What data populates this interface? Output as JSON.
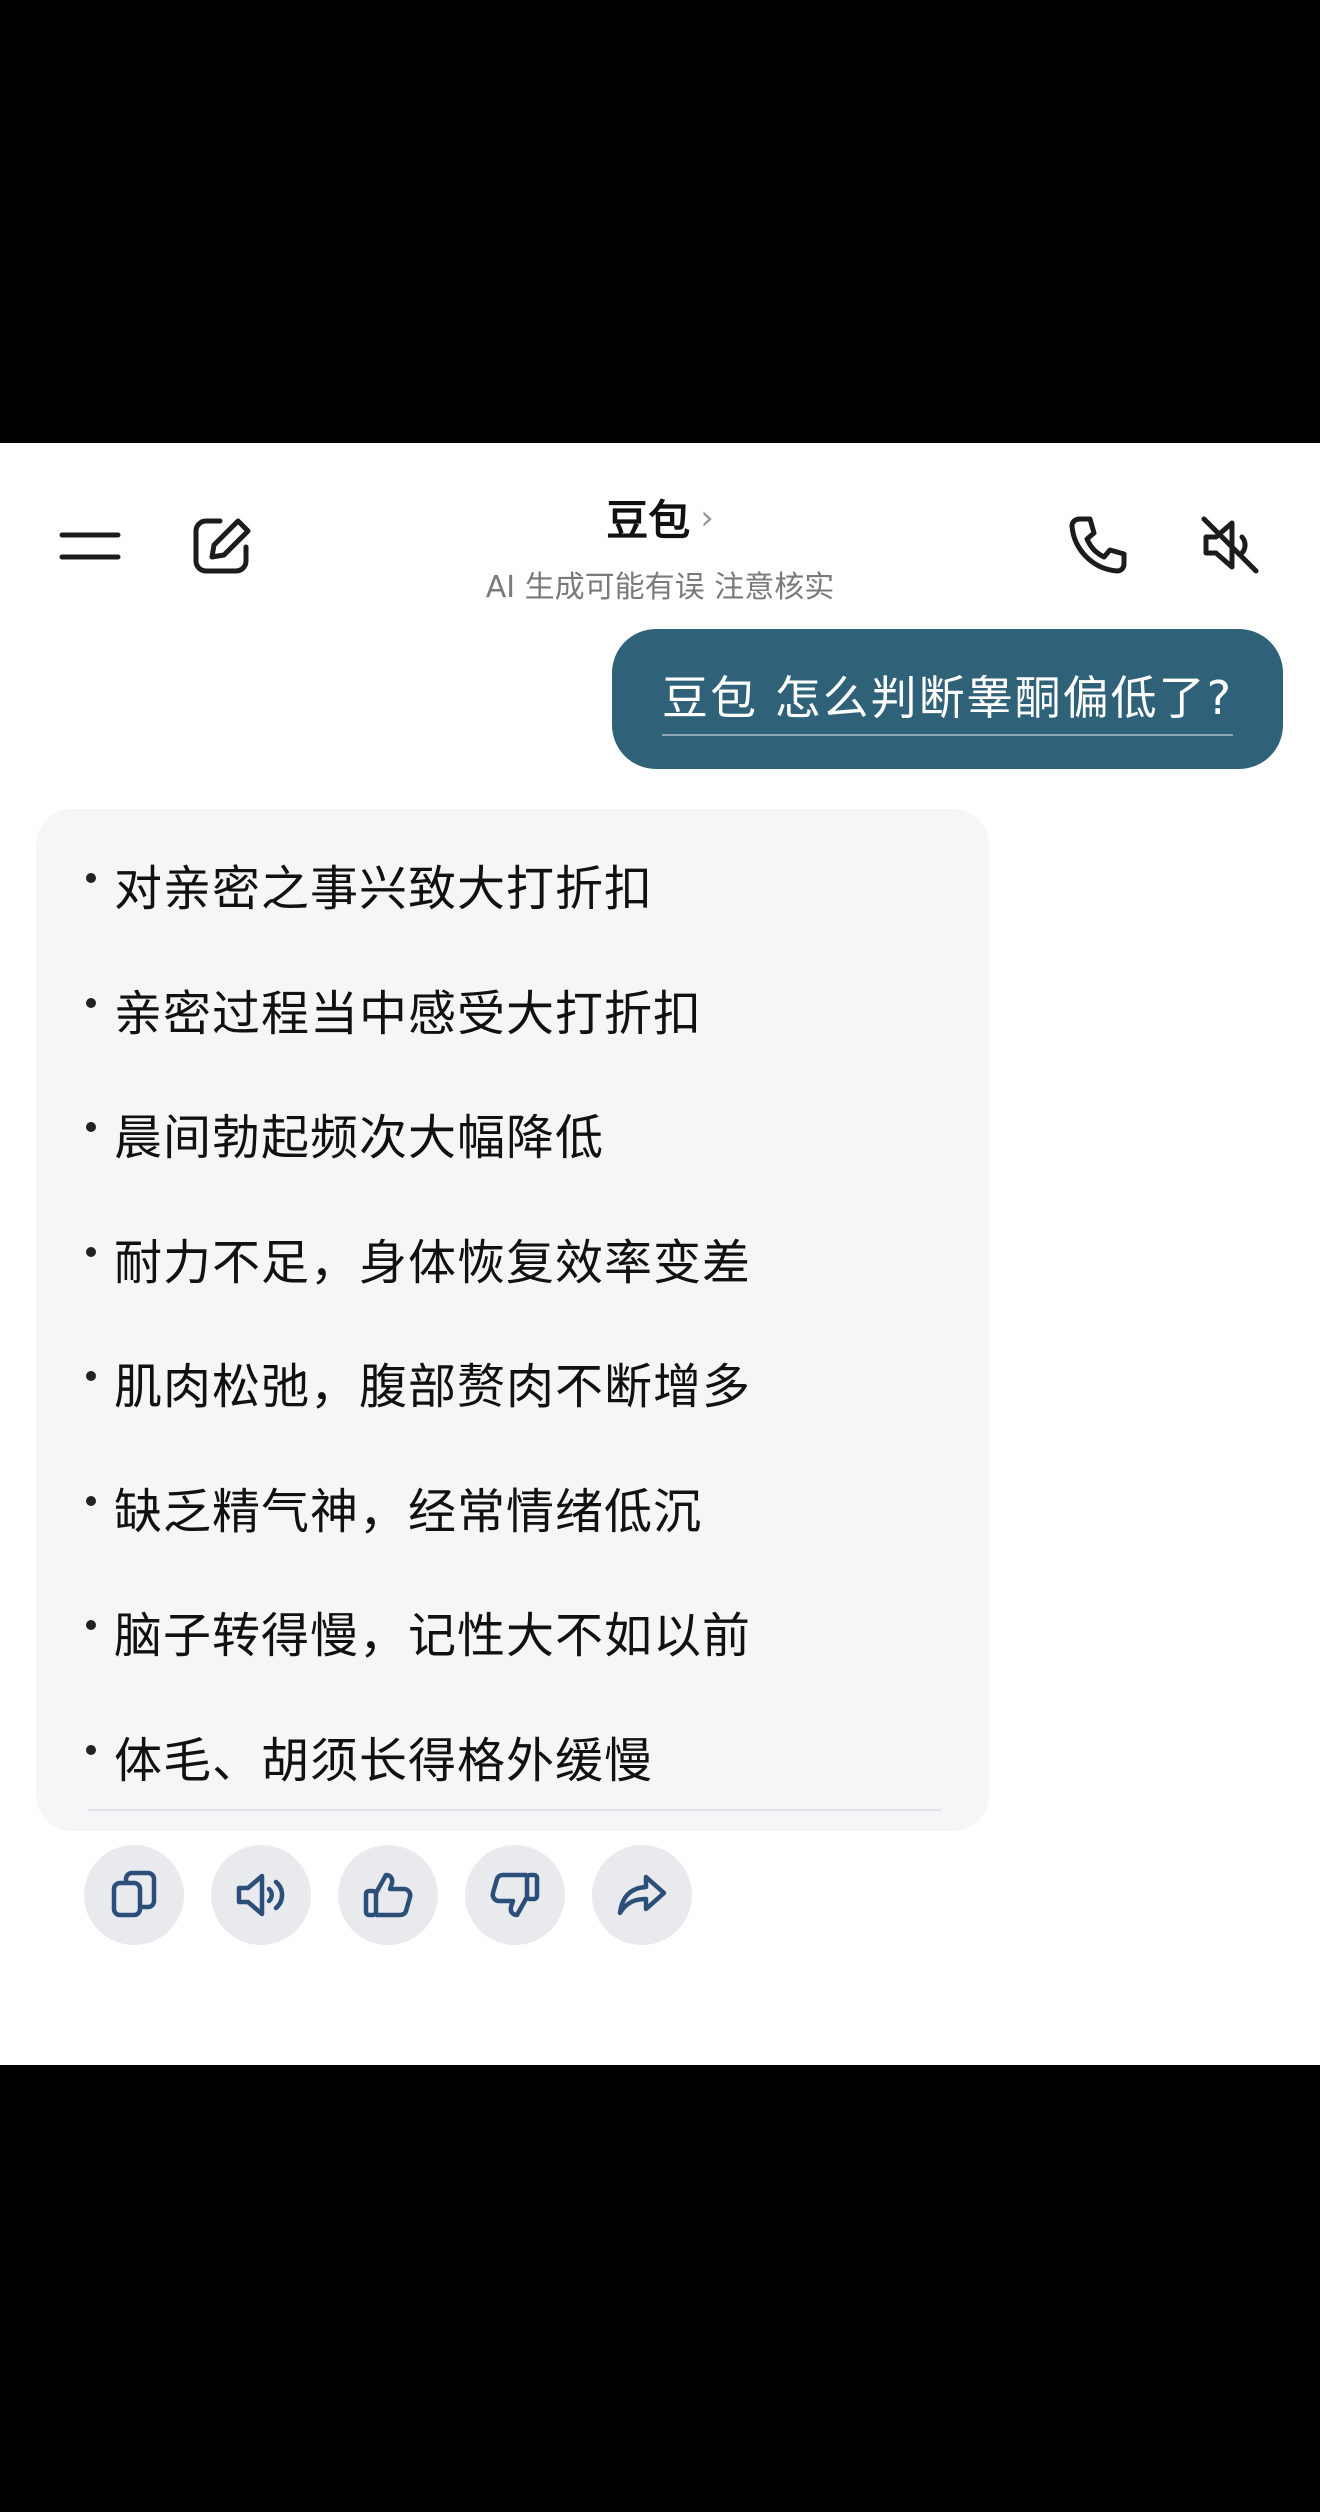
{
  "header": {
    "title": "豆包",
    "title_chevron": "›",
    "subtitle": "AI 生成可能有误 注意核实"
  },
  "user_message": "豆包 怎么判断睾酮偏低了?",
  "answer": {
    "bullets": [
      "对亲密之事兴致大打折扣",
      "亲密过程当中感受大打折扣",
      "晨间勃起频次大幅降低",
      "耐力不足，身体恢复效率变差",
      "肌肉松弛，腹部赘肉不断增多",
      "缺乏精气神，经常情绪低沉",
      "脑子转得慢，记性大不如以前",
      "体毛、胡须长得格外缓慢"
    ]
  },
  "icons": {
    "menu": "menu-icon",
    "edit": "edit-icon",
    "call": "phone-icon",
    "mute": "speaker-muted-icon",
    "copy": "copy-icon",
    "speak": "speaker-icon",
    "like": "thumbs-up-icon",
    "dislike": "thumbs-down-icon",
    "share": "share-icon"
  },
  "colors": {
    "user_bubble": "#2f6279",
    "card_bg": "#f5f6f8",
    "icon_blue": "#2c4f7a"
  }
}
